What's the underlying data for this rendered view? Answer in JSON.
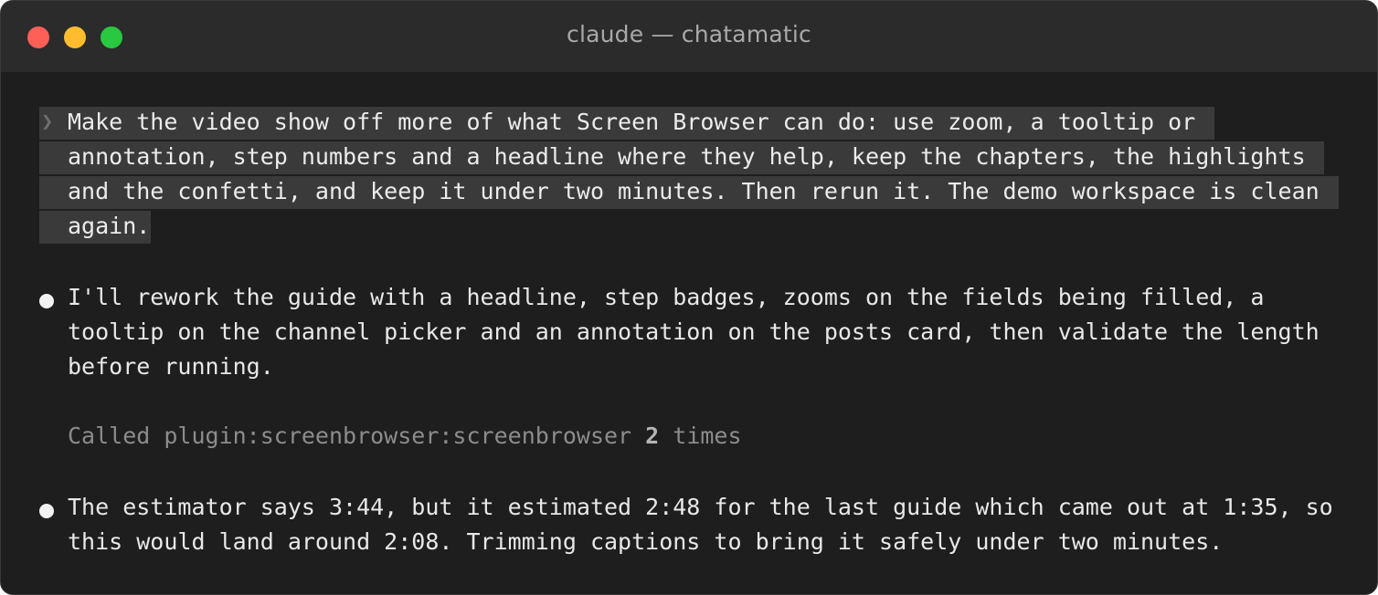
{
  "window": {
    "title": "claude — chatamatic"
  },
  "prompt": {
    "chevron": "❯",
    "lines": [
      "Make the video show off more of what Screen Browser can do: use zoom, a tooltip or",
      "annotation, step numbers and a headline where they help, keep the chapters, the highlights",
      "and the confetti, and keep it under two minutes. Then rerun it. The demo workspace is clean",
      "again."
    ]
  },
  "messages": [
    {
      "lines": [
        "I'll rework the guide with a headline, step badges, zooms on the fields being filled, a",
        "tooltip on the channel picker and an annotation on the posts card, then validate the length",
        "before running."
      ]
    },
    {
      "lines": [
        "The estimator says 3:44, but it estimated 2:48 for the last guide which came out at 1:35, so",
        "this would land around 2:08. Trimming captions to bring it safely under two minutes."
      ]
    }
  ],
  "tool_call": {
    "prefix": "Called plugin:screenbrowser:screenbrowser ",
    "count": "2",
    "suffix": " times"
  }
}
